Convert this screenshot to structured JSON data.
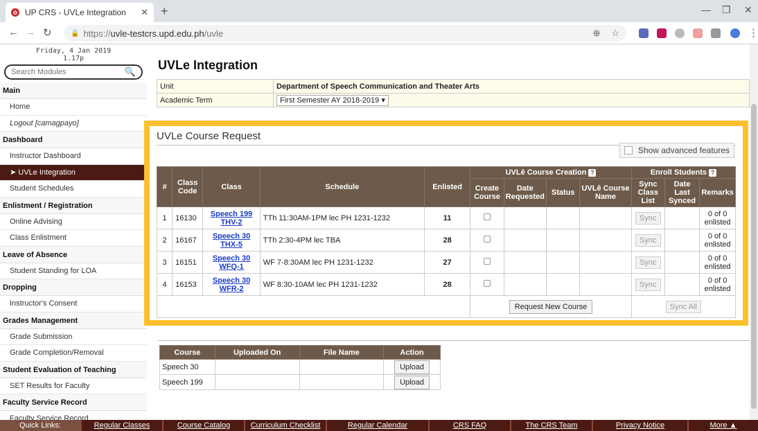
{
  "browser": {
    "tab_title": "UP CRS - UVLe Integration",
    "url_secure": "https://",
    "url_host": "uvle-testcrs.upd.edu.ph",
    "url_path": "/uvle"
  },
  "sidebar": {
    "date": "Friday, 4 Jan 2019",
    "time": "1.17p",
    "search_placeholder": "Search Modules",
    "sections": [
      {
        "title": "Main",
        "items": [
          "Home",
          "Logout [camagpayo]"
        ]
      },
      {
        "title": "Dashboard",
        "items": [
          "Instructor Dashboard",
          "UVLe Integration",
          "Student Schedules"
        ]
      },
      {
        "title": "Enlistment / Registration",
        "items": [
          "Online Advising",
          "Class Enlistment"
        ]
      },
      {
        "title": "Leave of Absence",
        "items": [
          "Student Standing for LOA"
        ]
      },
      {
        "title": "Dropping",
        "items": [
          "Instructor's Consent"
        ]
      },
      {
        "title": "Grades Management",
        "items": [
          "Grade Submission",
          "Grade Completion/Removal"
        ]
      },
      {
        "title": "Student Evaluation of Teaching",
        "items": [
          "SET Results for Faculty"
        ]
      },
      {
        "title": "Faculty Service Record",
        "items": [
          "Faculty Service Record"
        ]
      }
    ]
  },
  "main": {
    "title": "UVLe Integration",
    "unit_label": "Unit",
    "unit_value": "Department of Speech Communication and Theater Arts",
    "term_label": "Academic Term",
    "term_value": "First Semester AY 2018-2019"
  },
  "modal": {
    "title": "UVLe Course Request",
    "advanced_label": "Show advanced features",
    "group_creation": "UVLê Course Creation",
    "group_enroll": "Enroll Students",
    "headers": [
      "#",
      "Class Code",
      "Class",
      "Schedule",
      "Enlisted",
      "Create Course",
      "Date Requested",
      "Status",
      "UVLê Course Name",
      "Sync Class List",
      "Date Last Synced",
      "Remarks"
    ],
    "rows": [
      {
        "num": "1",
        "code": "16130",
        "class1": "Speech 199",
        "class2": "THV-2",
        "schedule": "TTh 11:30AM-1PM lec PH 1231-1232",
        "enlisted": "11",
        "remarks": "0 of 0 enlisted"
      },
      {
        "num": "2",
        "code": "16167",
        "class1": "Speech 30",
        "class2": "THX-5",
        "schedule": "TTh 2:30-4PM lec TBA",
        "enlisted": "28",
        "remarks": "0 of 0 enlisted"
      },
      {
        "num": "3",
        "code": "16151",
        "class1": "Speech 30",
        "class2": "WFQ-1",
        "schedule": "WF 7-8:30AM lec PH 1231-1232",
        "enlisted": "27",
        "remarks": "0 of 0 enlisted"
      },
      {
        "num": "4",
        "code": "16153",
        "class1": "Speech 30",
        "class2": "WFR-2",
        "schedule": "WF 8:30-10AM lec PH 1231-1232",
        "enlisted": "28",
        "remarks": "0 of 0 enlisted"
      }
    ],
    "sync_label": "Sync",
    "request_new": "Request New Course",
    "sync_all": "Sync All"
  },
  "syllabus": {
    "headers": [
      "Course",
      "Uploaded On",
      "File Name",
      "Action"
    ],
    "rows": [
      {
        "course": "Speech 30"
      },
      {
        "course": "Speech 199"
      }
    ],
    "upload_label": "Upload"
  },
  "footer": {
    "links": [
      "Quick Links:",
      "Regular Classes",
      "Course Catalog",
      "Curriculum Checklist",
      "Regular Calendar",
      "CRS FAQ",
      "The CRS Team",
      "Privacy Notice",
      "More ▲"
    ]
  },
  "colors": {
    "accent": "#4b1a12",
    "table_header": "#6d5a4a",
    "highlight": "#fbc02d"
  }
}
